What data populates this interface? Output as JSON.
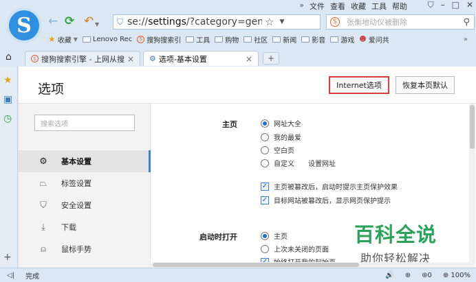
{
  "menu": {
    "chevron": "»",
    "items": [
      "文件",
      "查看",
      "收藏",
      "工具",
      "帮助"
    ],
    "window_controls": [
      "⛉",
      "–",
      "□",
      "✕"
    ]
  },
  "nav": {
    "url_prefix": "se://",
    "url_host": "settings",
    "url_rest": "/?category=gen",
    "search_placeholder": "张衡地动仪被删除"
  },
  "bookmarks": {
    "items": [
      {
        "label": "收藏",
        "icon": "star-icon"
      },
      {
        "label": "Lenovo Rec",
        "icon": "folder-icon"
      },
      {
        "label": "搜狗搜索引",
        "icon": "sogou-icon"
      },
      {
        "label": "工具",
        "icon": "folder-icon"
      },
      {
        "label": "购物",
        "icon": "folder-icon"
      },
      {
        "label": "社区",
        "icon": "folder-icon"
      },
      {
        "label": "新闻",
        "icon": "folder-icon"
      },
      {
        "label": "影音",
        "icon": "folder-icon"
      },
      {
        "label": "游戏",
        "icon": "folder-icon"
      },
      {
        "label": "爱问共",
        "icon": "user-icon"
      }
    ],
    "more": "»"
  },
  "tabs": [
    {
      "label": "搜狗搜索引擎 - 上网从搜",
      "active": false
    },
    {
      "label": "选项-基本设置",
      "active": true
    }
  ],
  "page": {
    "title": "选项",
    "internet_button": "Internet选项",
    "restore_button": "恢复本页默认",
    "search_placeholder": "搜索选项"
  },
  "left_nav": [
    {
      "label": "基本设置",
      "icon": "gear-icon",
      "active": true
    },
    {
      "label": "标签设置",
      "icon": "tab-icon",
      "active": false
    },
    {
      "label": "安全设置",
      "icon": "shield-icon",
      "active": false
    },
    {
      "label": "下载",
      "icon": "download-icon",
      "active": false
    },
    {
      "label": "鼠标手势",
      "icon": "mouse-icon",
      "active": false
    }
  ],
  "settings": {
    "homepage_label": "主页",
    "homepage_options": [
      "网址大全",
      "我的最爱",
      "空白页",
      "自定义"
    ],
    "homepage_selected": 0,
    "set_url_link": "设置网址",
    "homepage_checks": [
      {
        "label": "主页被篡改后，启动时提示主页保护效果",
        "checked": true
      },
      {
        "label": "目标网站被篡改后，显示网页保护提示",
        "checked": true
      }
    ],
    "startup_label": "启动时打开",
    "startup_options": [
      "主页",
      "上次未关闭的页面",
      "始终打开我的起始页"
    ],
    "startup_selected": 0
  },
  "watermark": {
    "title": "百科全说",
    "subtitle": "助你轻松解决"
  },
  "status": {
    "left_icon": "◁|",
    "text": "完成",
    "right_items": [
      "🔊",
      "⊕",
      "⊛0",
      "⊕ 100%"
    ]
  }
}
